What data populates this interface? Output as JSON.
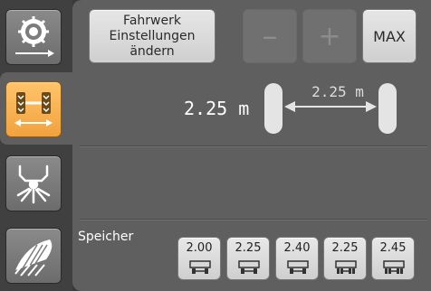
{
  "sidebar": {
    "items": [
      {
        "icon": "wheel-arrow-icon",
        "active": false
      },
      {
        "icon": "track-width-icon",
        "active": true
      },
      {
        "icon": "hitch-icon",
        "active": false
      },
      {
        "icon": "spreader-icon",
        "active": false
      }
    ],
    "active_color": "#f4a640"
  },
  "toolbar": {
    "settings_label": "Fahrwerk\nEinstellungen\nändern",
    "minus_label": "–",
    "plus_label": "+",
    "max_label": "MAX"
  },
  "track_width": {
    "current_value": "2.25 m",
    "diagram_value": "2.25 m"
  },
  "memory": {
    "label": "Speicher",
    "slots": [
      {
        "value": "2.00",
        "icon": "axle-single-icon"
      },
      {
        "value": "2.25",
        "icon": "axle-single-icon"
      },
      {
        "value": "2.40",
        "icon": "axle-single-icon"
      },
      {
        "value": "2.25",
        "icon": "axle-double-icon"
      },
      {
        "value": "2.45",
        "icon": "axle-double-icon"
      }
    ]
  }
}
